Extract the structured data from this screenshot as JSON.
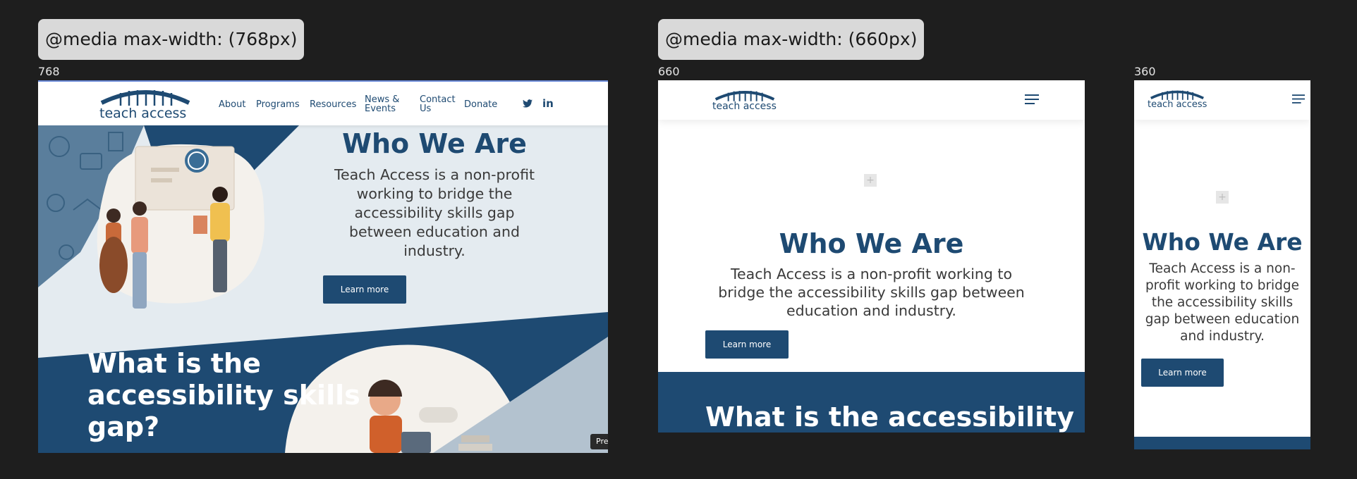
{
  "tags": {
    "t768": "@media max-width: (768px)",
    "t660": "@media max-width: (660px)"
  },
  "widths": {
    "w768": "768",
    "w660": "660",
    "w360": "360"
  },
  "brand": {
    "name": "teach access",
    "navy": "#1e4a72",
    "light_bg": "#e4ebf0"
  },
  "nav": {
    "about": "About",
    "programs": "Programs",
    "resources": "Resources",
    "news_1": "News &",
    "news_2": "Events",
    "contact_1": "Contact",
    "contact_2": "Us",
    "donate": "Donate"
  },
  "social": {
    "twitter": "twitter-icon",
    "linkedin": "in"
  },
  "hero": {
    "title": "Who We Are",
    "desc_768": [
      "Teach Access is a non-profit",
      "working to bridge the",
      "accessibility skills gap",
      "between education and",
      "industry."
    ],
    "desc_660": [
      "Teach Access is a non-profit working to",
      "bridge the accessibility skills gap between",
      "education and industry."
    ],
    "desc_360": [
      "Teach Access is a non-",
      "profit working to bridge",
      "the accessibility skills",
      "gap between education",
      "and industry."
    ],
    "button": "Learn more"
  },
  "gap": {
    "title_768": [
      "What is the",
      "accessibility skills",
      "gap?"
    ],
    "title_660": "What is the accessibility"
  },
  "pre_badge": "Pre"
}
